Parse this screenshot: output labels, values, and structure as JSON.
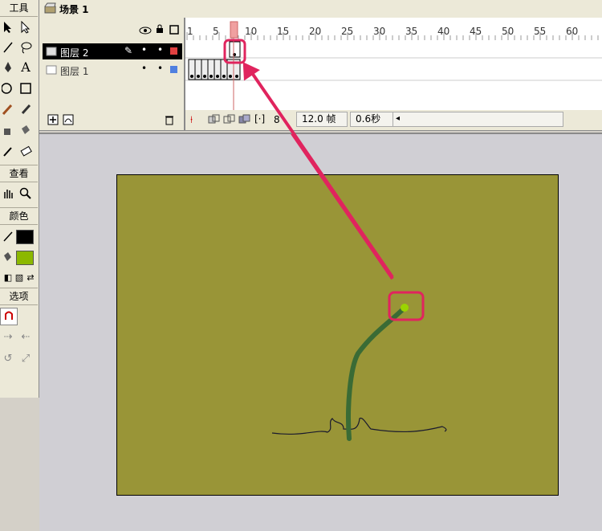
{
  "tools_panel": {
    "title": "工具",
    "view_title": "查看",
    "colors_title": "颜色",
    "options_title": "选项",
    "stroke_color": "#000000",
    "fill_color": "#8cb800"
  },
  "scene": {
    "label": "场景 1"
  },
  "timeline": {
    "ruler": [
      "1",
      "5",
      "10",
      "15",
      "20",
      "25",
      "30",
      "35",
      "40",
      "45",
      "50",
      "55",
      "60"
    ],
    "layers": [
      {
        "name": "图层 2",
        "color": "#e04040",
        "selected": true
      },
      {
        "name": "图层 1",
        "color": "#5080e0",
        "selected": false
      }
    ],
    "fps": "12.0 帧",
    "time": "0.6秒",
    "current_frame": 8
  },
  "stage": {
    "background": "#999537",
    "stem_color": "#3a6b35",
    "bud_color": "#9bd400",
    "highlight_color": "#e0245e"
  }
}
